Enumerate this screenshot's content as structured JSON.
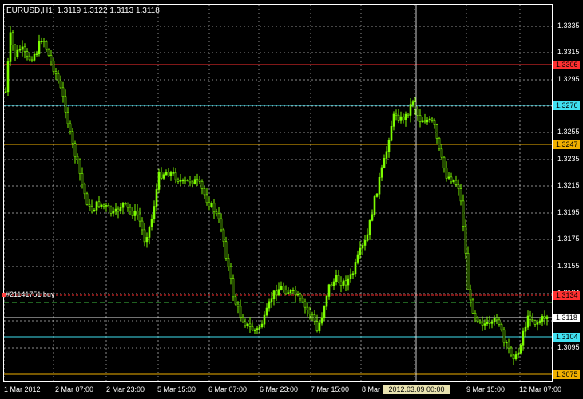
{
  "window": {
    "symbol_info": "EURUSD,H1  1.3119 1.3122 1.3113 1.3118"
  },
  "trade": {
    "label": "#21141751 buy"
  },
  "price_axis": {
    "ticks": [
      "1.3335",
      "1.3315",
      "1.3295",
      "1.3275",
      "1.3255",
      "1.3235",
      "1.3215",
      "1.3195",
      "1.3175",
      "1.3155",
      "1.3134",
      "1.3115",
      "1.3095"
    ]
  },
  "price_tags": [
    {
      "name": "resistance-red",
      "value": "1.3306",
      "color": "#ff3030"
    },
    {
      "name": "resistance-cyan",
      "value": "1.3276",
      "color": "#40e0f0"
    },
    {
      "name": "level-orange",
      "value": "1.3247",
      "color": "#f0b000"
    },
    {
      "name": "trade-open",
      "value": "1.3134",
      "color": "#ff3030"
    },
    {
      "name": "current-bid",
      "value": "1.3118",
      "color": "#ffffff"
    },
    {
      "name": "support-cyan",
      "value": "1.3104",
      "color": "#40e0f0"
    },
    {
      "name": "support-orange",
      "value": "1.3075",
      "color": "#f0b000"
    }
  ],
  "time_axis": {
    "labels": [
      "1 Mar 2012",
      "2 Mar 07:00",
      "2 Mar 23:00",
      "5 Mar 15:00",
      "6 Mar 07:00",
      "6 Mar 23:00",
      "7 Mar 15:00",
      "8 Mar",
      "9 Mar 15:00",
      "12 Mar 07:00"
    ],
    "cursor_label": "2012.03.09 00:00"
  },
  "colors": {
    "candle": "#7CFC00",
    "grid": "#ffffff",
    "axis": "#ffffff",
    "background": "#000000"
  }
}
